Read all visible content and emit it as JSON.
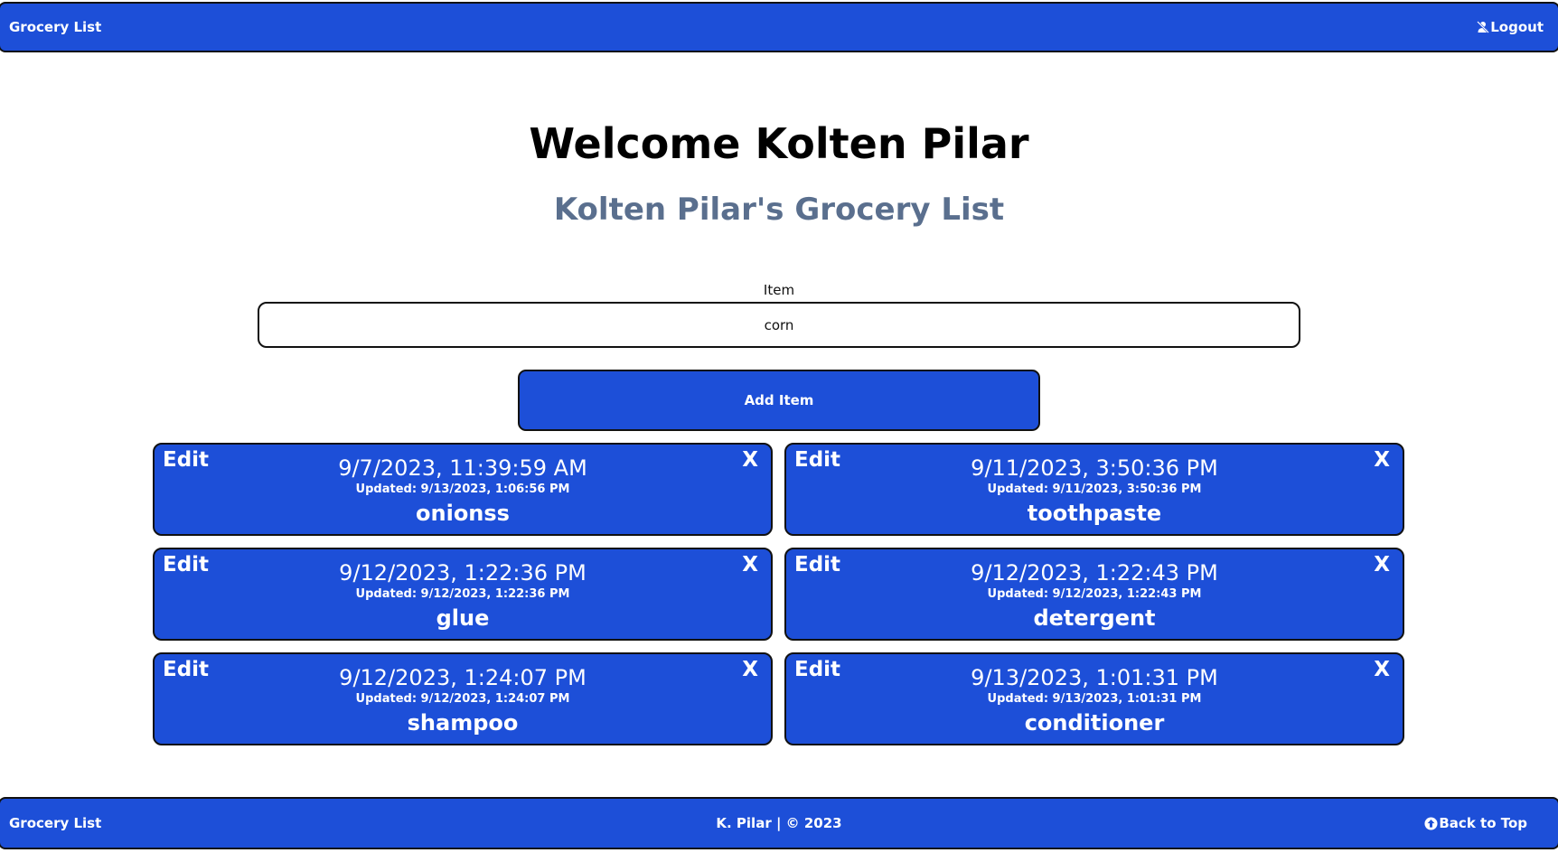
{
  "header": {
    "brand": "Grocery List",
    "logout_label": "Logout",
    "logout_icon": "user-slash-icon"
  },
  "main": {
    "title": "Welcome Kolten Pilar",
    "subtitle": "Kolten Pilar's Grocery List",
    "form": {
      "label": "Item",
      "value": "corn",
      "button_label": "Add Item"
    },
    "edit_label": "Edit",
    "close_label": "X",
    "items": [
      {
        "created": "9/7/2023, 11:39:59 AM",
        "updated": "Updated: 9/13/2023, 1:06:56 PM",
        "name": "onionss"
      },
      {
        "created": "9/11/2023, 3:50:36 PM",
        "updated": "Updated: 9/11/2023, 3:50:36 PM",
        "name": "toothpaste"
      },
      {
        "created": "9/12/2023, 1:22:36 PM",
        "updated": "Updated: 9/12/2023, 1:22:36 PM",
        "name": "glue"
      },
      {
        "created": "9/12/2023, 1:22:43 PM",
        "updated": "Updated: 9/12/2023, 1:22:43 PM",
        "name": "detergent"
      },
      {
        "created": "9/12/2023, 1:24:07 PM",
        "updated": "Updated: 9/12/2023, 1:24:07 PM",
        "name": "shampoo"
      },
      {
        "created": "9/13/2023, 1:01:31 PM",
        "updated": "Updated: 9/13/2023, 1:01:31 PM",
        "name": "conditioner"
      }
    ]
  },
  "footer": {
    "brand": "Grocery List",
    "copyright": "K. Pilar | © 2023",
    "back_to_top_label": "Back to Top",
    "back_to_top_icon": "arrow-circle-up-icon"
  },
  "colors": {
    "primary": "#1d4fd8",
    "subtitle": "#5a6f8e",
    "border": "#111111"
  }
}
